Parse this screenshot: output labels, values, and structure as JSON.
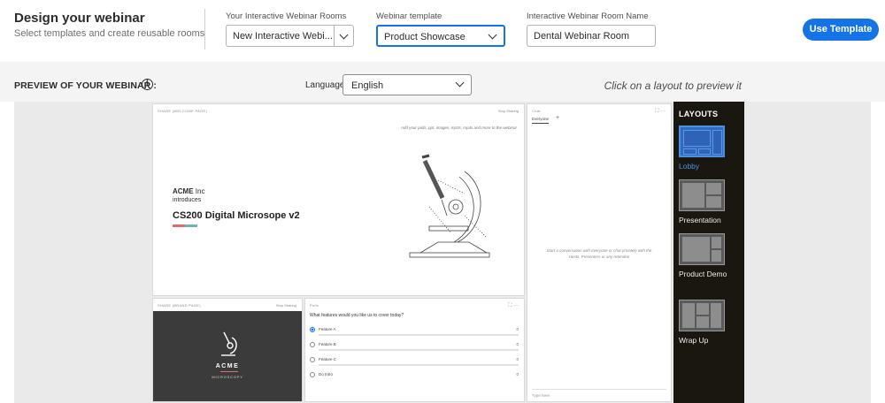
{
  "header": {
    "title": "Design your webinar",
    "subtitle": "Select templates and create reusable rooms",
    "rooms": {
      "label": "Your Interactive Webinar Rooms",
      "value": "New Interactive Webi..."
    },
    "template": {
      "label": "Webinar template",
      "value": "Product Showcase"
    },
    "room_name": {
      "label": "Interactive Webinar Room Name",
      "value": "Dental Webinar Room"
    },
    "use_template_label": "Use Template",
    "accent_color": "#1473e6"
  },
  "preview": {
    "title": "PREVIEW OF YOUR WEBINAR :",
    "info_icon": "info-icon",
    "language_label": "Language",
    "language_value": "English",
    "hint": "Click on a layout to preview it"
  },
  "stage": {
    "share_pod": {
      "header": "SHARE (WELCOME PAGE)",
      "stop_label": "Stop Sharing",
      "add_text": "Add your polls, ppt, images, mp3s, mp4s and more to the webinar",
      "company": "ACME",
      "company_suffix": "Inc",
      "introduces": "introduces",
      "product": "CS200 Digital Microsope v2"
    },
    "logo_pod": {
      "header": "SHARE (BRAND PAGE)",
      "stop_label": "Stop Sharing",
      "brand": "ACME",
      "brand_sub": "MICROSCOPY"
    },
    "poll_pod": {
      "header": "Polls",
      "question": "What features would you like us to cover today?",
      "options": [
        {
          "label": "Feature A",
          "count": "0",
          "selected": true
        },
        {
          "label": "Feature B",
          "count": "0",
          "selected": false
        },
        {
          "label": "Feature C",
          "count": "0",
          "selected": false
        },
        {
          "label": "Do Intro",
          "count": "0",
          "selected": false
        }
      ]
    },
    "chat_pod": {
      "header": "Chat",
      "tab": "Everyone",
      "add_tab": "+",
      "empty_text": "Start a conversation with everyone or chat privately with the Hosts, Presenters or any Attendee",
      "input_placeholder": "Type here"
    }
  },
  "layouts": {
    "title": "LAYOUTS",
    "items": [
      {
        "label": "Lobby",
        "selected": true
      },
      {
        "label": "Presentation",
        "selected": false
      },
      {
        "label": "Product Demo",
        "selected": false
      },
      {
        "label": "Wrap Up",
        "selected": false
      }
    ]
  }
}
